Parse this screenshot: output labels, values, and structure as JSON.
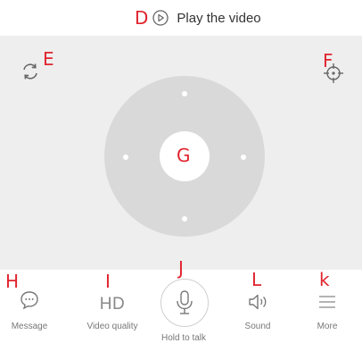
{
  "top": {
    "play_label": "Play the video",
    "play_marker": "D"
  },
  "markers": {
    "refresh": "E",
    "locate": "F",
    "center": "G",
    "message": "H",
    "quality": "I",
    "talk": "J",
    "sound": "L",
    "more": "k"
  },
  "toolbar": {
    "message_label": "Message",
    "quality_value": "HD",
    "quality_label": "Video quality",
    "talk_label": "Hold to talk",
    "sound_label": "Sound",
    "more_label": "More"
  },
  "icons": {
    "play": "play-circle-icon",
    "refresh": "refresh-icon",
    "locate": "crosshair-icon",
    "message": "message-bubble-icon",
    "microphone": "microphone-icon",
    "sound": "speaker-icon",
    "more": "menu-lines-icon"
  },
  "colors": {
    "marker": "#e0242e",
    "stage": "#eeeeee",
    "dpad": "#d9d9d9"
  }
}
